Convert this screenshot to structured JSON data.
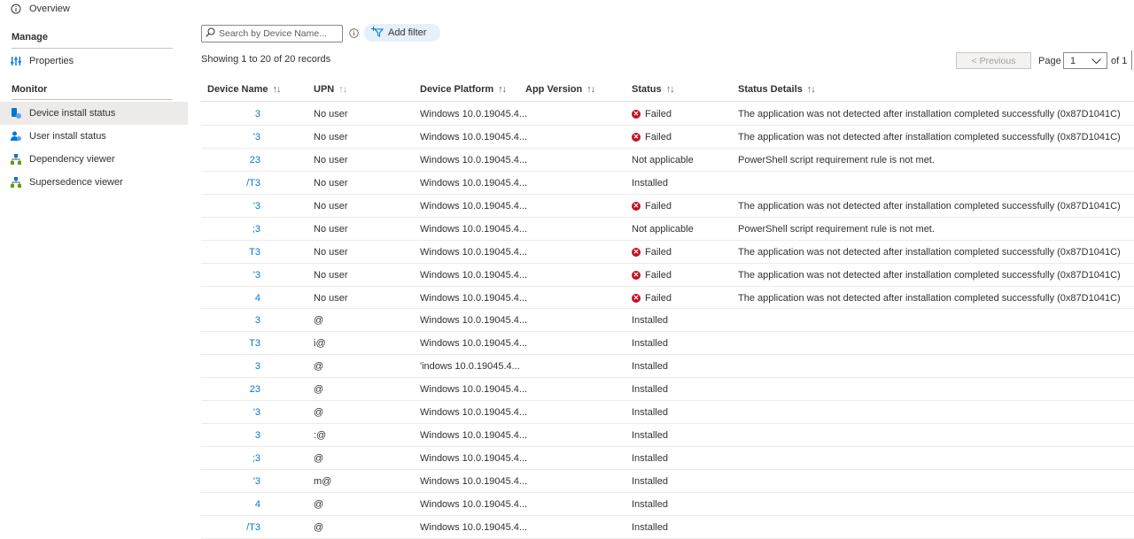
{
  "sidebar": {
    "overview": "Overview",
    "manage_header": "Manage",
    "properties": "Properties",
    "monitor_header": "Monitor",
    "items": [
      {
        "label": "Device install status",
        "icon": "device-status-icon"
      },
      {
        "label": "User install status",
        "icon": "user-status-icon"
      },
      {
        "label": "Dependency viewer",
        "icon": "dependency-icon"
      },
      {
        "label": "Supersedence viewer",
        "icon": "supersedence-icon"
      }
    ]
  },
  "toolbar": {
    "search_placeholder": "Search by Device Name...",
    "add_filter": "Add filter"
  },
  "records_text": "Showing 1 to 20 of 20 records",
  "pagination": {
    "previous": "< Previous",
    "page_label": "Page",
    "page_value": "1",
    "of_label": "of 1"
  },
  "table": {
    "columns": {
      "device_name": "Device Name",
      "upn": "UPN",
      "platform": "Device Platform",
      "app_version": "App Version",
      "status": "Status",
      "status_details": "Status Details"
    },
    "sort_glyph": "↑↓",
    "rows": [
      {
        "device": "3",
        "upn": "No user",
        "platform": "Windows 10.0.19045.4...",
        "status": "Failed",
        "failed": true,
        "details": "The application was not detected after installation completed successfully (0x87D1041C)"
      },
      {
        "device": "'3",
        "upn": "No user",
        "platform": "Windows 10.0.19045.4...",
        "status": "Failed",
        "failed": true,
        "details": "The application was not detected after installation completed successfully (0x87D1041C)"
      },
      {
        "device": "23",
        "upn": "No user",
        "platform": "Windows 10.0.19045.4...",
        "status": "Not applicable",
        "failed": false,
        "details": "PowerShell script requirement rule is not met."
      },
      {
        "device": "/T3",
        "upn": "No user",
        "platform": "Windows 10.0.19045.4...",
        "status": "Installed",
        "failed": false,
        "details": ""
      },
      {
        "device": "'3",
        "upn": "No user",
        "platform": "Windows 10.0.19045.4...",
        "status": "Failed",
        "failed": true,
        "details": "The application was not detected after installation completed successfully (0x87D1041C)"
      },
      {
        "device": ";3",
        "upn": "No user",
        "platform": "Windows 10.0.19045.4...",
        "status": "Not applicable",
        "failed": false,
        "details": "PowerShell script requirement rule is not met."
      },
      {
        "device": "T3",
        "upn": "No user",
        "platform": "Windows 10.0.19045.4...",
        "status": "Failed",
        "failed": true,
        "details": "The application was not detected after installation completed successfully (0x87D1041C)"
      },
      {
        "device": "'3",
        "upn": "No user",
        "platform": "Windows 10.0.19045.4...",
        "status": "Failed",
        "failed": true,
        "details": "The application was not detected after installation completed successfully (0x87D1041C)"
      },
      {
        "device": "4",
        "upn": "No user",
        "platform": "Windows 10.0.19045.4...",
        "status": "Failed",
        "failed": true,
        "details": "The application was not detected after installation completed successfully (0x87D1041C)"
      },
      {
        "device": "3",
        "upn": "@",
        "platform": "Windows 10.0.19045.4...",
        "status": "Installed",
        "failed": false,
        "details": ""
      },
      {
        "device": "T3",
        "upn": "i@",
        "platform": "Windows 10.0.19045.4...",
        "status": "Installed",
        "failed": false,
        "details": ""
      },
      {
        "device": "3",
        "upn": "@",
        "platform": "'indows 10.0.19045.4...",
        "status": "Installed",
        "failed": false,
        "details": ""
      },
      {
        "device": "23",
        "upn": "@",
        "platform": "Windows 10.0.19045.4...",
        "status": "Installed",
        "failed": false,
        "details": ""
      },
      {
        "device": "'3",
        "upn": "@",
        "platform": "Windows 10.0.19045.4...",
        "status": "Installed",
        "failed": false,
        "details": ""
      },
      {
        "device": "3",
        "upn": ":@",
        "platform": "Windows 10.0.19045.4...",
        "status": "Installed",
        "failed": false,
        "details": ""
      },
      {
        "device": ";3",
        "upn": "@",
        "platform": "Windows 10.0.19045.4...",
        "status": "Installed",
        "failed": false,
        "details": ""
      },
      {
        "device": "'3",
        "upn": "m@",
        "platform": "Windows 10.0.19045.4...",
        "status": "Installed",
        "failed": false,
        "details": ""
      },
      {
        "device": "4",
        "upn": "@",
        "platform": "Windows 10.0.19045.4...",
        "status": "Installed",
        "failed": false,
        "details": ""
      },
      {
        "device": "/T3",
        "upn": "@",
        "platform": "Windows 10.0.19045.4...",
        "status": "Installed",
        "failed": false,
        "details": ""
      }
    ]
  },
  "colors": {
    "link": "#0078d4",
    "failed": "#c50f1f",
    "active_nav": "#edebe9",
    "filter_pill": "#e6f0fa"
  }
}
